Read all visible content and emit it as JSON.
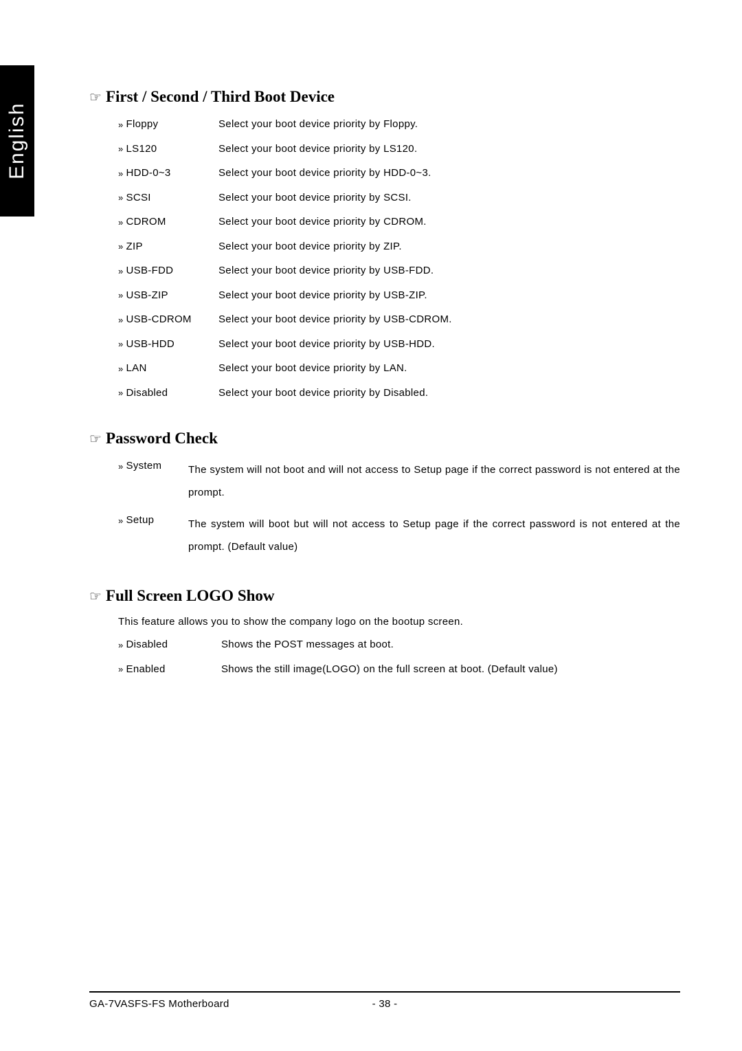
{
  "language_tab": "English",
  "sections": [
    {
      "title": "First / Second / Third Boot Device",
      "options": [
        {
          "label": "Floppy",
          "desc": "Select your boot device priority by Floppy."
        },
        {
          "label": "LS120",
          "desc": "Select your boot device priority by LS120."
        },
        {
          "label": "HDD-0~3",
          "desc": "Select your boot device priority by HDD-0~3."
        },
        {
          "label": "SCSI",
          "desc": "Select your boot device priority by SCSI."
        },
        {
          "label": "CDROM",
          "desc": "Select your boot device priority by CDROM."
        },
        {
          "label": "ZIP",
          "desc": "Select your boot device priority by ZIP."
        },
        {
          "label": "USB-FDD",
          "desc": "Select your boot device priority by USB-FDD."
        },
        {
          "label": "USB-ZIP",
          "desc": "Select your boot device priority by USB-ZIP."
        },
        {
          "label": "USB-CDROM",
          "desc": "Select your boot device priority by USB-CDROM."
        },
        {
          "label": "USB-HDD",
          "desc": "Select your boot device priority by USB-HDD."
        },
        {
          "label": "LAN",
          "desc": "Select your boot device priority by LAN."
        },
        {
          "label": "Disabled",
          "desc": "Select your boot device priority by Disabled."
        }
      ]
    },
    {
      "title": "Password Check",
      "options": [
        {
          "label": "System",
          "desc": "The system will not boot and will not access to Setup page if the correct password is not entered at the prompt."
        },
        {
          "label": "Setup",
          "desc": "The system will boot but will not access to Setup page if the correct password is not entered at the prompt. (Default value)"
        }
      ]
    },
    {
      "title": "Full Screen LOGO Show",
      "intro": "This feature allows you to show the company logo on the bootup screen.",
      "options": [
        {
          "label": "Disabled",
          "desc": "Shows the POST messages at boot."
        },
        {
          "label": "Enabled",
          "desc": "Shows the still image(LOGO) on the full screen at boot. (Default value)"
        }
      ]
    }
  ],
  "footer": {
    "left": "GA-7VASFS-FS Motherboard",
    "center": "- 38 -"
  },
  "icons": {
    "hand": "☞",
    "arrow": "»"
  }
}
